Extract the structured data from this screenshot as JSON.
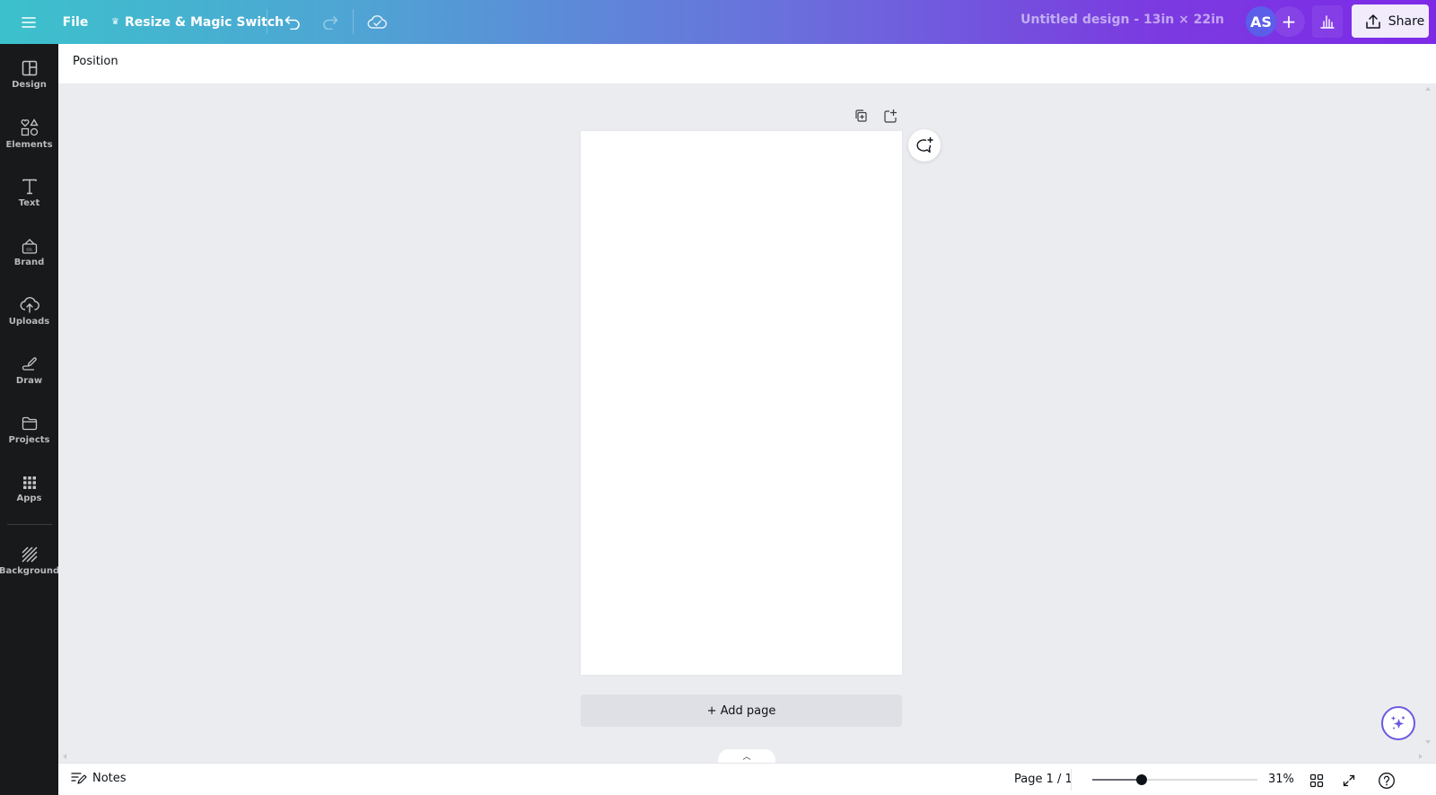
{
  "topbar": {
    "file_label": "File",
    "resize_label": "Resize & Magic Switch",
    "design_title": "Untitled design - 13in × 22in",
    "avatar_initials": "AS",
    "share_label": "Share"
  },
  "sidebar": {
    "items": [
      {
        "label": "Design",
        "icon": "design-icon"
      },
      {
        "label": "Elements",
        "icon": "elements-icon"
      },
      {
        "label": "Text",
        "icon": "text-icon"
      },
      {
        "label": "Brand",
        "icon": "brand-icon"
      },
      {
        "label": "Uploads",
        "icon": "uploads-icon"
      },
      {
        "label": "Draw",
        "icon": "draw-icon"
      },
      {
        "label": "Projects",
        "icon": "projects-icon"
      },
      {
        "label": "Apps",
        "icon": "apps-icon"
      },
      {
        "label": "Background",
        "icon": "background-icon"
      }
    ]
  },
  "context_toolbar": {
    "position_label": "Position"
  },
  "canvas": {
    "add_page_label": "+ Add page"
  },
  "footer": {
    "notes_label": "Notes",
    "page_indicator": "Page 1 / 1",
    "zoom_percent": 31,
    "zoom_label": "31%",
    "zoom_slider_fraction": 0.3
  },
  "colors": {
    "gradient_start": "#3cc1cc",
    "gradient_end": "#7d2ae8",
    "sidebar_bg": "#18191b",
    "canvas_bg": "#ebecf0",
    "avatar_bg": "#5a5ee8",
    "share_bg": "#f1ebfc"
  }
}
